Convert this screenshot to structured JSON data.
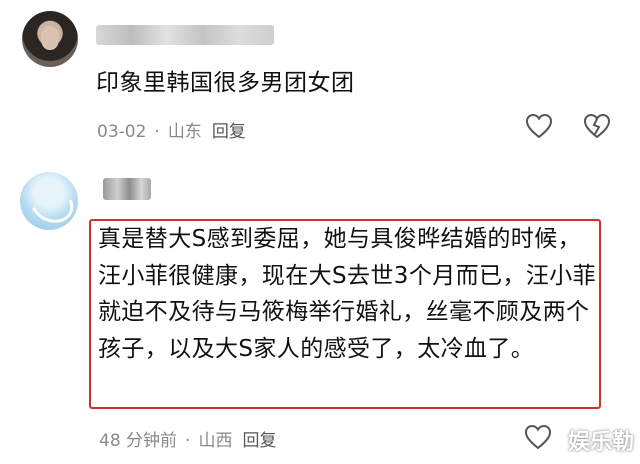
{
  "comments": [
    {
      "text": "印象里韩国很多男团女团",
      "time": "03-02",
      "location": "山东",
      "reply_label": "回复"
    },
    {
      "text": "真是替大S感到委屈，她与具俊晔结婚的时候，汪小菲很健康，现在大S去世3个月而已，汪小菲就迫不及待与马筱梅举行婚礼，丝毫不顾及两个孩子，以及大S家人的感受了，太冷血了。",
      "time": "48 分钟前",
      "location": "山西",
      "reply_label": "回复"
    }
  ],
  "separator": "·",
  "watermark": "娱乐勒",
  "colors": {
    "highlight_border": "#d0312d",
    "meta": "#8a8a8a"
  }
}
